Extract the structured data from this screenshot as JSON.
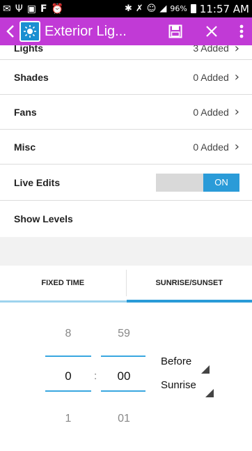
{
  "status_bar": {
    "battery": "96%",
    "time": "11:57 AM"
  },
  "action_bar": {
    "title": "Exterior Lig...",
    "accent": "#c13ad6"
  },
  "list": [
    {
      "label": "Lights",
      "value": "3 Added"
    },
    {
      "label": "Shades",
      "value": "0 Added"
    },
    {
      "label": "Fans",
      "value": "0 Added"
    },
    {
      "label": "Misc",
      "value": "0 Added"
    }
  ],
  "live_edits": {
    "label": "Live Edits",
    "state": "ON"
  },
  "show_levels": {
    "label": "Show Levels"
  },
  "tabs": [
    {
      "label": "FIXED TIME",
      "selected": false
    },
    {
      "label": "SUNRISE/SUNSET",
      "selected": true
    }
  ],
  "picker": {
    "hour": {
      "above": "8",
      "current": "0",
      "below": "1"
    },
    "minute": {
      "above": "59",
      "current": "00",
      "below": "01"
    },
    "separator": ":",
    "offset": "Before",
    "event": "Sunrise"
  }
}
